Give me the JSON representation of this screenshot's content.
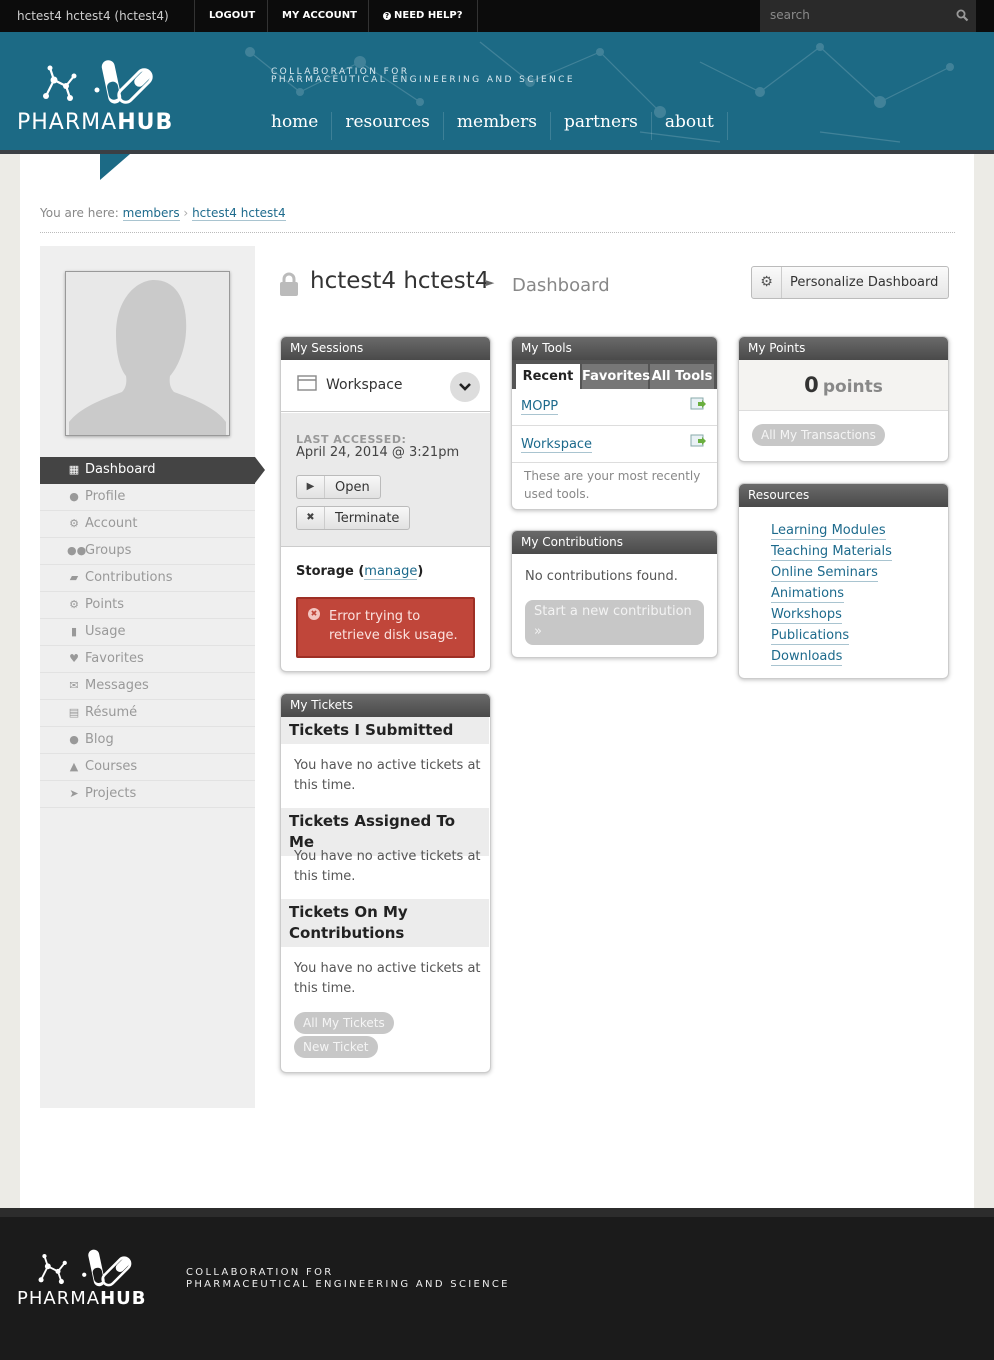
{
  "topbar": {
    "user": "hctest4 hctest4 (hctest4)",
    "logout": "LOGOUT",
    "my_account": "MY ACCOUNT",
    "need_help": "NEED HELP?",
    "search_placeholder": "search"
  },
  "header": {
    "logo_text": "PHARMAHUB",
    "tagline_line1": "COLLABORATION FOR",
    "tagline_line2": "PHARMACEUTICAL ENGINEERING AND SCIENCE",
    "nav": [
      "home",
      "resources",
      "members",
      "partners",
      "about"
    ]
  },
  "breadcrumb": {
    "prefix": "You are here:",
    "items": [
      "members",
      "hctest4 hctest4"
    ]
  },
  "sidebar": {
    "items": [
      {
        "label": "Dashboard",
        "icon": "dashboard-icon",
        "active": true
      },
      {
        "label": "Profile",
        "icon": "profile-icon"
      },
      {
        "label": "Account",
        "icon": "account-icon"
      },
      {
        "label": "Groups",
        "icon": "groups-icon"
      },
      {
        "label": "Contributions",
        "icon": "contributions-icon"
      },
      {
        "label": "Points",
        "icon": "points-icon"
      },
      {
        "label": "Usage",
        "icon": "usage-icon"
      },
      {
        "label": "Favorites",
        "icon": "heart-icon"
      },
      {
        "label": "Messages",
        "icon": "envelope-icon"
      },
      {
        "label": "Résumé",
        "icon": "document-icon"
      },
      {
        "label": "Blog",
        "icon": "speech-bubble-icon"
      },
      {
        "label": "Courses",
        "icon": "graduation-cap-icon"
      },
      {
        "label": "Projects",
        "icon": "paper-plane-icon"
      }
    ]
  },
  "page": {
    "name": "hctest4 hctest4",
    "section": "Dashboard",
    "personalize_label": "Personalize Dashboard"
  },
  "sessions": {
    "title": "My Sessions",
    "session_name": "Workspace",
    "last_accessed_label": "LAST ACCESSED:",
    "last_accessed_value": "April 24, 2014 @ 3:21pm",
    "open_label": "Open",
    "terminate_label": "Terminate",
    "storage_label": "Storage",
    "storage_manage": "manage",
    "error_text": "Error trying to retrieve disk usage."
  },
  "tools": {
    "title": "My Tools",
    "tabs": [
      "Recent",
      "Favorites",
      "All Tools"
    ],
    "items": [
      "MOPP",
      "Workspace"
    ],
    "note": "These are your most recently used tools."
  },
  "contributions": {
    "title": "My Contributions",
    "empty_text": "No contributions found.",
    "button_label": "Start a new contribution »"
  },
  "points": {
    "title": "My Points",
    "value": "0",
    "unit": "points",
    "button_label": "All My Transactions"
  },
  "resources": {
    "title": "Resources",
    "links": [
      "Learning Modules",
      "Teaching Materials",
      "Online Seminars",
      "Animations",
      "Workshops",
      "Publications",
      "Downloads"
    ]
  },
  "tickets": {
    "title": "My Tickets",
    "submitted_heading": "Tickets I Submitted",
    "submitted_text": "You have no active tickets at this time.",
    "assigned_heading": "Tickets Assigned To Me",
    "assigned_text": "You have no active tickets at this time.",
    "contrib_heading": "Tickets On My Contributions",
    "contrib_text": "You have no active tickets at this time.",
    "all_label": "All My Tickets",
    "new_label": "New Ticket"
  },
  "colors": {
    "header_blue": "#1c6a85",
    "link_blue": "#1d6a8c",
    "error_red": "#c0463a",
    "sidebar_active": "#444444"
  }
}
